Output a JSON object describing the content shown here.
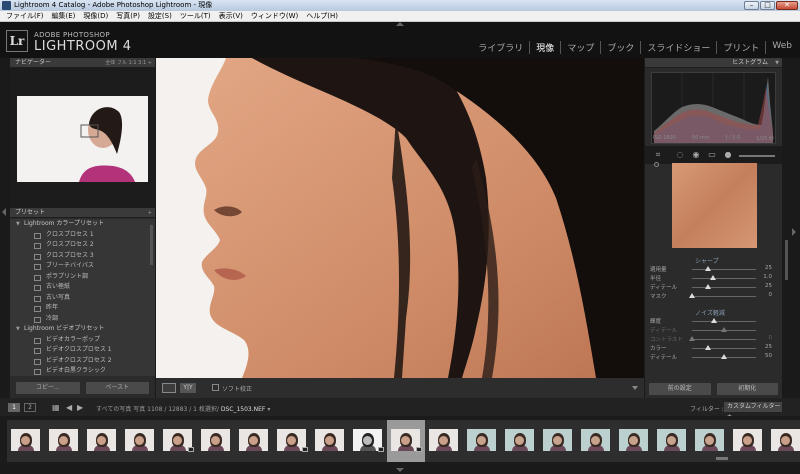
{
  "window": {
    "title": "Lightroom 4 Catalog - Adobe Photoshop Lightroom - 現像"
  },
  "menu": [
    "ファイル(F)",
    "編集(E)",
    "現像(D)",
    "写真(P)",
    "設定(S)",
    "ツール(T)",
    "表示(V)",
    "ウィンドウ(W)",
    "ヘルプ(H)"
  ],
  "brand": {
    "logo": "Lr",
    "line1": "ADOBE PHOTOSHOP",
    "line2": "LIGHTROOM 4"
  },
  "modules": [
    {
      "label": "ライブラリ",
      "active": false
    },
    {
      "label": "現像",
      "active": true
    },
    {
      "label": "マップ",
      "active": false
    },
    {
      "label": "ブック",
      "active": false
    },
    {
      "label": "スライドショー",
      "active": false
    },
    {
      "label": "プリント",
      "active": false
    },
    {
      "label": "Web",
      "active": false
    }
  ],
  "navigator": {
    "title": "ナビゲーター",
    "zoom_options": "全体  フル  1:1  3:1 ÷"
  },
  "presets": {
    "title": "プリセット",
    "add": "+",
    "items": [
      {
        "kind": "group",
        "label": "Lightroom カラープリセット"
      },
      {
        "kind": "item",
        "label": "クロスプロセス 1"
      },
      {
        "kind": "item",
        "label": "クロスプロセス 2"
      },
      {
        "kind": "item",
        "label": "クロスプロセス 3"
      },
      {
        "kind": "item",
        "label": "ブリーチバイパス"
      },
      {
        "kind": "item",
        "label": "ポラプリント調"
      },
      {
        "kind": "item",
        "label": "古い極紙"
      },
      {
        "kind": "item",
        "label": "古い写真"
      },
      {
        "kind": "item",
        "label": "昨年"
      },
      {
        "kind": "item",
        "label": "冷調"
      },
      {
        "kind": "group",
        "label": "Lightroom ビデオプリセット"
      },
      {
        "kind": "item",
        "label": "ビデオカラーポップ"
      },
      {
        "kind": "item",
        "label": "ビデオクロスプロセス 1"
      },
      {
        "kind": "item",
        "label": "ビデオクロスプロセス 2"
      },
      {
        "kind": "item",
        "label": "ビデオ白黒クラシック"
      }
    ]
  },
  "left_buttons": {
    "copy": "コピー...",
    "paste": "ペースト"
  },
  "toolbar": {
    "yy": "Y|Y",
    "soft_proof": "ソフト校正"
  },
  "histogram": {
    "title": "ヒストグラム",
    "iso": "ISO 1600",
    "focal": "50 mm",
    "aperture": "ƒ / 5.6",
    "shutter": "1/25 秒"
  },
  "sharpen": {
    "title": "シャープ",
    "rows": [
      {
        "label": "適用量",
        "value": "25",
        "pos": 0.25,
        "dim": false
      },
      {
        "label": "半径",
        "value": "1.0",
        "pos": 0.33,
        "dim": false
      },
      {
        "label": "ディテール",
        "value": "25",
        "pos": 0.25,
        "dim": false
      },
      {
        "label": "マスク",
        "value": "0",
        "pos": 0.0,
        "dim": false
      }
    ]
  },
  "noise": {
    "title": "ノイズ軽減",
    "rows": [
      {
        "label": "輝度",
        "value": "",
        "pos": 0.35,
        "dim": false
      },
      {
        "label": "ディテール",
        "value": "",
        "pos": 0.5,
        "dim": true
      },
      {
        "label": "コントラスト",
        "value": "0",
        "pos": 0.0,
        "dim": true
      },
      {
        "label": "カラー",
        "value": "25",
        "pos": 0.25,
        "dim": false
      },
      {
        "label": "ディテール",
        "value": "50",
        "pos": 0.5,
        "dim": false
      }
    ]
  },
  "right_buttons": {
    "previous": "前の設定",
    "reset": "初期化"
  },
  "filmbar": {
    "btn1": "1",
    "btn2": "2",
    "path_prefix": "すべての写真  写真 1108 / 12883 / 1 枚選択/",
    "filename": "DSC_1503.NEF",
    "filename_suffix": "▾",
    "filter_label": "フィルター :",
    "filter_value": "カスタムフィルター ÷"
  },
  "thumbnails": [
    {
      "tone": "color",
      "badge": false,
      "selected": false
    },
    {
      "tone": "color",
      "badge": false,
      "selected": false
    },
    {
      "tone": "color",
      "badge": false,
      "selected": false
    },
    {
      "tone": "color",
      "badge": false,
      "selected": false
    },
    {
      "tone": "color",
      "badge": true,
      "selected": false
    },
    {
      "tone": "color",
      "badge": false,
      "selected": false
    },
    {
      "tone": "color",
      "badge": false,
      "selected": false
    },
    {
      "tone": "color",
      "badge": true,
      "selected": false
    },
    {
      "tone": "color",
      "badge": false,
      "selected": false
    },
    {
      "tone": "bw",
      "badge": true,
      "selected": false
    },
    {
      "tone": "color",
      "badge": true,
      "selected": true
    },
    {
      "tone": "color",
      "badge": false,
      "selected": false
    },
    {
      "tone": "teal",
      "badge": false,
      "selected": false
    },
    {
      "tone": "teal",
      "badge": false,
      "selected": false
    },
    {
      "tone": "teal",
      "badge": false,
      "selected": false
    },
    {
      "tone": "teal",
      "badge": false,
      "selected": false
    },
    {
      "tone": "teal",
      "badge": false,
      "selected": false
    },
    {
      "tone": "teal",
      "badge": false,
      "selected": false
    },
    {
      "tone": "teal",
      "badge": false,
      "selected": false
    },
    {
      "tone": "color",
      "badge": false,
      "selected": false
    },
    {
      "tone": "color",
      "badge": false,
      "selected": false
    }
  ],
  "colors": {
    "ui_bg": "#2b2b2b",
    "accent_label": "#8da0b8",
    "skin": "#d38e6a"
  }
}
